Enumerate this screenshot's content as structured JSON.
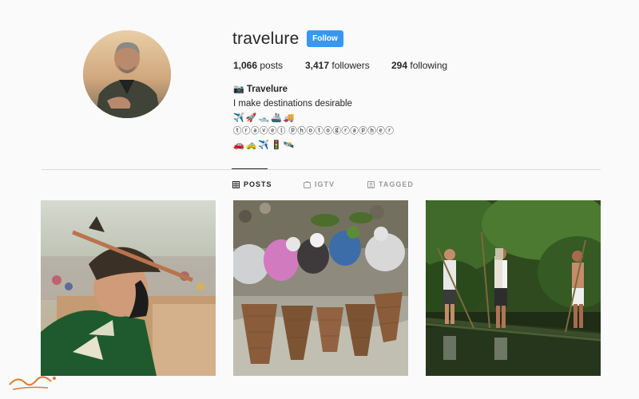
{
  "profile": {
    "username": "travelure",
    "follow_label": "Follow",
    "stats": {
      "posts_count": "1,066",
      "posts_label": "posts",
      "followers_count": "3,417",
      "followers_label": "followers",
      "following_count": "294",
      "following_label": "following"
    },
    "bio": {
      "name_emoji": "📷",
      "name": "Travelure",
      "tagline": "I make destinations desirable",
      "emoji_line_1": [
        "✈️",
        "🚀",
        "🛥️",
        "🚢",
        "🚚"
      ],
      "circled_text": "ⓣⓡⓐⓥⓔⓛ ⓟⓗⓞⓣⓞⓖⓡⓐⓟⓗⓔⓡ",
      "emoji_line_2": [
        "🚗",
        "🚕",
        "✈️",
        "🚦",
        "🛰️"
      ]
    }
  },
  "tabs": [
    {
      "label": "POSTS",
      "icon": "grid-icon",
      "active": true
    },
    {
      "label": "IGTV",
      "icon": "igtv-icon",
      "active": false
    },
    {
      "label": "TAGGED",
      "icon": "tagged-icon",
      "active": false
    }
  ],
  "posts": [
    {
      "description": "man-with-feather-hat"
    },
    {
      "description": "fishing-baskets-in-river"
    },
    {
      "description": "men-on-bamboo-raft"
    }
  ],
  "colors": {
    "follow_button": "#3897f0",
    "text": "#262626",
    "muted": "#999999",
    "divider": "#dbdbdb",
    "background": "#fafafa"
  }
}
